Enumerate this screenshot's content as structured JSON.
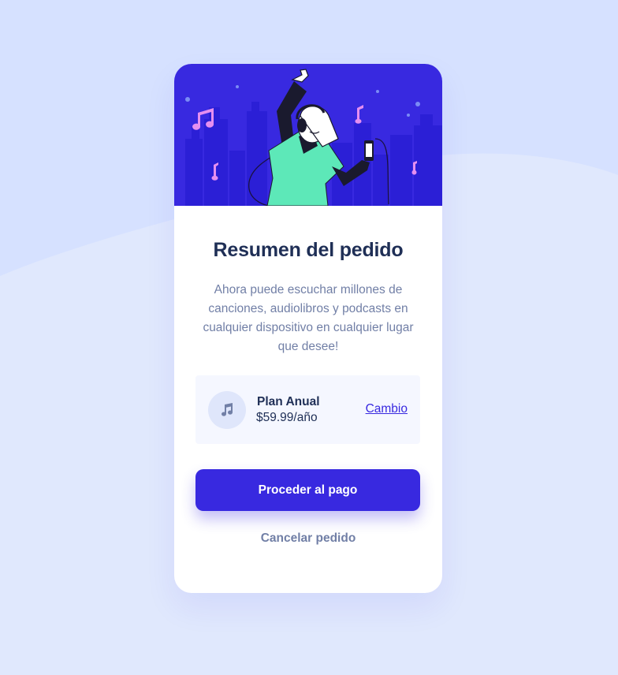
{
  "colors": {
    "background": "#e0e8fd",
    "background_wave": "#d6e1ff",
    "hero_background": "#3829e0",
    "primary": "#3829e0",
    "heading": "#1f2f56",
    "muted": "#717fa6",
    "plan_panel": "#f5f7ff",
    "card": "#ffffff"
  },
  "hero": {
    "icon": "person-dancing-with-headphones-illustration"
  },
  "summary": {
    "title": "Resumen del pedido",
    "description": "Ahora puede escuchar millones de canciones, audiolibros y podcasts en cualquier dispositivo en cualquier lugar que desee!"
  },
  "plan": {
    "icon": "music-note-icon",
    "name": "Plan Anual",
    "price": "$59.99/año",
    "change_label": "Cambio"
  },
  "actions": {
    "proceed_label": "Proceder al pago",
    "cancel_label": "Cancelar pedido"
  }
}
